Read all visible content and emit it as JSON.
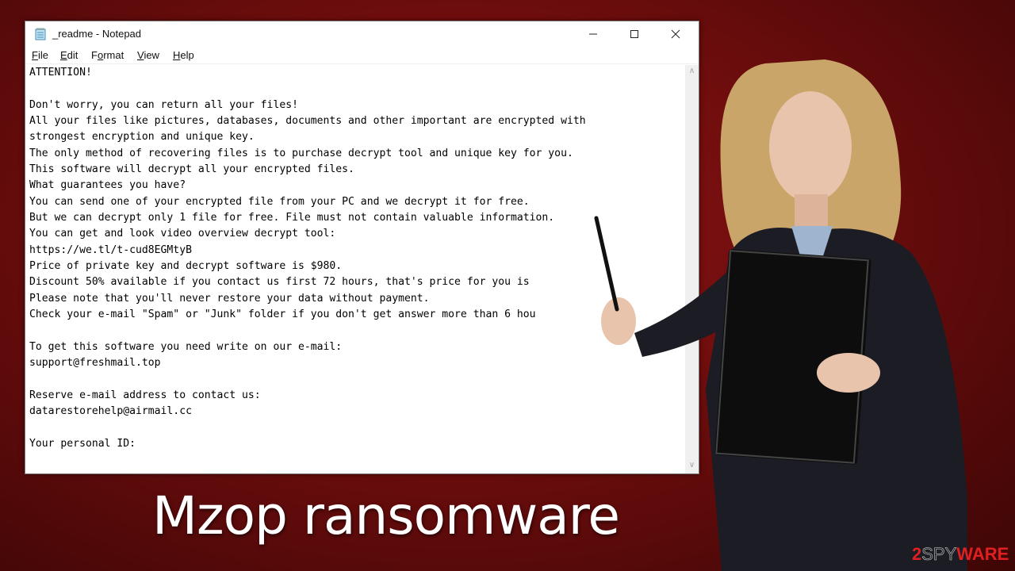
{
  "window": {
    "title": "_readme - Notepad",
    "app_icon": "notepad-icon",
    "controls": {
      "minimize": "minimize-icon",
      "maximize": "maximize-icon",
      "close": "close-icon"
    }
  },
  "menu": {
    "items": [
      {
        "label": "File",
        "accel": "F",
        "rest": "ile"
      },
      {
        "label": "Edit",
        "accel": "E",
        "rest": "dit"
      },
      {
        "label": "Format",
        "accel": "o",
        "pre": "F",
        "rest": "rmat"
      },
      {
        "label": "View",
        "accel": "V",
        "rest": "iew"
      },
      {
        "label": "Help",
        "accel": "H",
        "rest": "elp"
      }
    ]
  },
  "document": {
    "lines": [
      "ATTENTION!",
      "",
      "Don't worry, you can return all your files!",
      "All your files like pictures, databases, documents and other important are encrypted with",
      "strongest encryption and unique key.",
      "The only method of recovering files is to purchase decrypt tool and unique key for you.",
      "This software will decrypt all your encrypted files.",
      "What guarantees you have?",
      "You can send one of your encrypted file from your PC and we decrypt it for free.",
      "But we can decrypt only 1 file for free. File must not contain valuable information.",
      "You can get and look video overview decrypt tool:",
      "https://we.tl/t-cud8EGMtyB",
      "Price of private key and decrypt software is $980.",
      "Discount 50% available if you contact us first 72 hours, that's price for you is",
      "Please note that you'll never restore your data without payment.",
      "Check your e-mail \"Spam\" or \"Junk\" folder if you don't get answer more than 6 hou",
      "",
      "To get this software you need write on our e-mail:",
      "support@freshmail.top",
      "",
      "Reserve e-mail address to contact us:",
      "datarestorehelp@airmail.cc",
      "",
      "Your personal ID:"
    ]
  },
  "scrollbar": {
    "up": "scroll-up-arrow-icon",
    "down": "scroll-down-arrow-icon"
  },
  "headline": "Mzop ransomware",
  "logo": {
    "prefix": "2",
    "mid": "SPY",
    "suffix": "WAR",
    "tail": "E"
  },
  "colors": {
    "background": "#6e0d0d",
    "logo_red": "#e02020"
  }
}
